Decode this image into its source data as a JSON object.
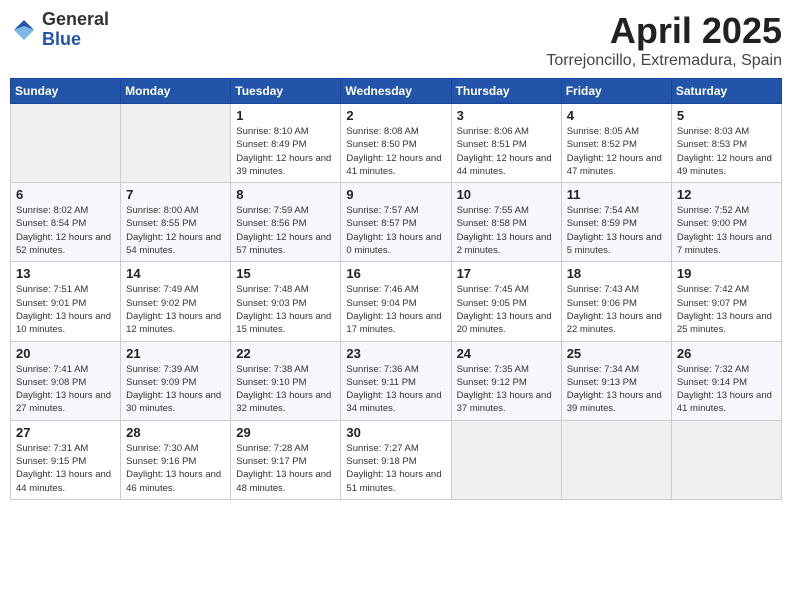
{
  "logo": {
    "general": "General",
    "blue": "Blue"
  },
  "header": {
    "month": "April 2025",
    "location": "Torrejoncillo, Extremadura, Spain"
  },
  "weekdays": [
    "Sunday",
    "Monday",
    "Tuesday",
    "Wednesday",
    "Thursday",
    "Friday",
    "Saturday"
  ],
  "weeks": [
    [
      {
        "day": "",
        "sunrise": "",
        "sunset": "",
        "daylight": ""
      },
      {
        "day": "",
        "sunrise": "",
        "sunset": "",
        "daylight": ""
      },
      {
        "day": "1",
        "sunrise": "Sunrise: 8:10 AM",
        "sunset": "Sunset: 8:49 PM",
        "daylight": "Daylight: 12 hours and 39 minutes."
      },
      {
        "day": "2",
        "sunrise": "Sunrise: 8:08 AM",
        "sunset": "Sunset: 8:50 PM",
        "daylight": "Daylight: 12 hours and 41 minutes."
      },
      {
        "day": "3",
        "sunrise": "Sunrise: 8:06 AM",
        "sunset": "Sunset: 8:51 PM",
        "daylight": "Daylight: 12 hours and 44 minutes."
      },
      {
        "day": "4",
        "sunrise": "Sunrise: 8:05 AM",
        "sunset": "Sunset: 8:52 PM",
        "daylight": "Daylight: 12 hours and 47 minutes."
      },
      {
        "day": "5",
        "sunrise": "Sunrise: 8:03 AM",
        "sunset": "Sunset: 8:53 PM",
        "daylight": "Daylight: 12 hours and 49 minutes."
      }
    ],
    [
      {
        "day": "6",
        "sunrise": "Sunrise: 8:02 AM",
        "sunset": "Sunset: 8:54 PM",
        "daylight": "Daylight: 12 hours and 52 minutes."
      },
      {
        "day": "7",
        "sunrise": "Sunrise: 8:00 AM",
        "sunset": "Sunset: 8:55 PM",
        "daylight": "Daylight: 12 hours and 54 minutes."
      },
      {
        "day": "8",
        "sunrise": "Sunrise: 7:59 AM",
        "sunset": "Sunset: 8:56 PM",
        "daylight": "Daylight: 12 hours and 57 minutes."
      },
      {
        "day": "9",
        "sunrise": "Sunrise: 7:57 AM",
        "sunset": "Sunset: 8:57 PM",
        "daylight": "Daylight: 13 hours and 0 minutes."
      },
      {
        "day": "10",
        "sunrise": "Sunrise: 7:55 AM",
        "sunset": "Sunset: 8:58 PM",
        "daylight": "Daylight: 13 hours and 2 minutes."
      },
      {
        "day": "11",
        "sunrise": "Sunrise: 7:54 AM",
        "sunset": "Sunset: 8:59 PM",
        "daylight": "Daylight: 13 hours and 5 minutes."
      },
      {
        "day": "12",
        "sunrise": "Sunrise: 7:52 AM",
        "sunset": "Sunset: 9:00 PM",
        "daylight": "Daylight: 13 hours and 7 minutes."
      }
    ],
    [
      {
        "day": "13",
        "sunrise": "Sunrise: 7:51 AM",
        "sunset": "Sunset: 9:01 PM",
        "daylight": "Daylight: 13 hours and 10 minutes."
      },
      {
        "day": "14",
        "sunrise": "Sunrise: 7:49 AM",
        "sunset": "Sunset: 9:02 PM",
        "daylight": "Daylight: 13 hours and 12 minutes."
      },
      {
        "day": "15",
        "sunrise": "Sunrise: 7:48 AM",
        "sunset": "Sunset: 9:03 PM",
        "daylight": "Daylight: 13 hours and 15 minutes."
      },
      {
        "day": "16",
        "sunrise": "Sunrise: 7:46 AM",
        "sunset": "Sunset: 9:04 PM",
        "daylight": "Daylight: 13 hours and 17 minutes."
      },
      {
        "day": "17",
        "sunrise": "Sunrise: 7:45 AM",
        "sunset": "Sunset: 9:05 PM",
        "daylight": "Daylight: 13 hours and 20 minutes."
      },
      {
        "day": "18",
        "sunrise": "Sunrise: 7:43 AM",
        "sunset": "Sunset: 9:06 PM",
        "daylight": "Daylight: 13 hours and 22 minutes."
      },
      {
        "day": "19",
        "sunrise": "Sunrise: 7:42 AM",
        "sunset": "Sunset: 9:07 PM",
        "daylight": "Daylight: 13 hours and 25 minutes."
      }
    ],
    [
      {
        "day": "20",
        "sunrise": "Sunrise: 7:41 AM",
        "sunset": "Sunset: 9:08 PM",
        "daylight": "Daylight: 13 hours and 27 minutes."
      },
      {
        "day": "21",
        "sunrise": "Sunrise: 7:39 AM",
        "sunset": "Sunset: 9:09 PM",
        "daylight": "Daylight: 13 hours and 30 minutes."
      },
      {
        "day": "22",
        "sunrise": "Sunrise: 7:38 AM",
        "sunset": "Sunset: 9:10 PM",
        "daylight": "Daylight: 13 hours and 32 minutes."
      },
      {
        "day": "23",
        "sunrise": "Sunrise: 7:36 AM",
        "sunset": "Sunset: 9:11 PM",
        "daylight": "Daylight: 13 hours and 34 minutes."
      },
      {
        "day": "24",
        "sunrise": "Sunrise: 7:35 AM",
        "sunset": "Sunset: 9:12 PM",
        "daylight": "Daylight: 13 hours and 37 minutes."
      },
      {
        "day": "25",
        "sunrise": "Sunrise: 7:34 AM",
        "sunset": "Sunset: 9:13 PM",
        "daylight": "Daylight: 13 hours and 39 minutes."
      },
      {
        "day": "26",
        "sunrise": "Sunrise: 7:32 AM",
        "sunset": "Sunset: 9:14 PM",
        "daylight": "Daylight: 13 hours and 41 minutes."
      }
    ],
    [
      {
        "day": "27",
        "sunrise": "Sunrise: 7:31 AM",
        "sunset": "Sunset: 9:15 PM",
        "daylight": "Daylight: 13 hours and 44 minutes."
      },
      {
        "day": "28",
        "sunrise": "Sunrise: 7:30 AM",
        "sunset": "Sunset: 9:16 PM",
        "daylight": "Daylight: 13 hours and 46 minutes."
      },
      {
        "day": "29",
        "sunrise": "Sunrise: 7:28 AM",
        "sunset": "Sunset: 9:17 PM",
        "daylight": "Daylight: 13 hours and 48 minutes."
      },
      {
        "day": "30",
        "sunrise": "Sunrise: 7:27 AM",
        "sunset": "Sunset: 9:18 PM",
        "daylight": "Daylight: 13 hours and 51 minutes."
      },
      {
        "day": "",
        "sunrise": "",
        "sunset": "",
        "daylight": ""
      },
      {
        "day": "",
        "sunrise": "",
        "sunset": "",
        "daylight": ""
      },
      {
        "day": "",
        "sunrise": "",
        "sunset": "",
        "daylight": ""
      }
    ]
  ]
}
